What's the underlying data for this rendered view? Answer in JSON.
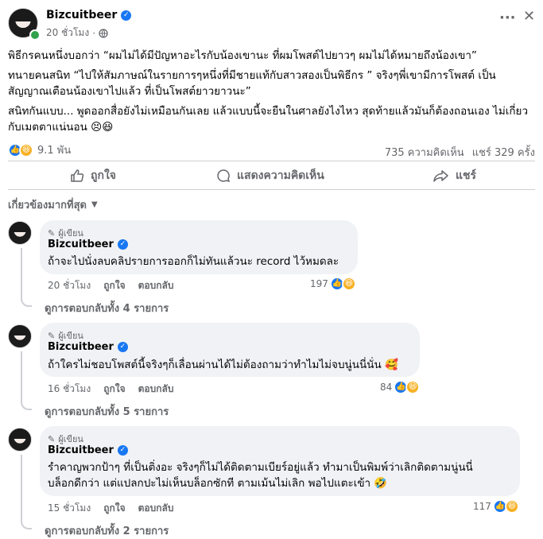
{
  "post": {
    "author": "Bizcuitbeer",
    "time": "20 ชั่วโมง",
    "privacy_icon": "globe-icon",
    "paragraphs": [
      "พิธีกรคนหนึ่งบอกว่า “ผมไม่ได้มีปัญหาอะไรกับน้องเขานะ ที่ผมโพสต์ไปยาวๆ ผมไม่ได้หมายถึงน้องเขา”",
      "ทนายคนสนิท “ไปให้สัมภาษณ์ในรายการๆหนึ่งที่มีชายแท้กับสาวสองเป็นพิธีกร ” จริงๆพี่เขามีการโพสต์ เป็นสัญญาณเตือนน้องเขาไปแล้ว ที่เป็นโพสต์ยาวยาวนะ”",
      "สนิทกันแบบ... พูดออกสื่อยังไม่เหมือนกันเลย แล้วแบบนี้จะยืนในศาลยังไงไหว สุดท้ายแล้วมันก็ต้องถอนเอง ไม่เกี่ยวกับเมตตาแน่นอน 😣😆"
    ],
    "reactions_count": "9.1 พัน",
    "comments_count": "735 ความคิดเห็น",
    "shares_count": "แชร์ 329 ครั้ง"
  },
  "actions": {
    "like": "ถูกใจ",
    "comment": "แสดงความคิดเห็น",
    "share": "แชร์"
  },
  "filter": {
    "label": "เกี่ยวข้องมากที่สุด"
  },
  "comments": [
    {
      "author_tag": "ผู้เขียน",
      "name": "Bizcuitbeer",
      "text": "ถ้าจะไปนั่งลบคลิปรายการออกก็ไม่ทันแล้วนะ record ไว้หมดละ",
      "time": "20 ชั่วโมง",
      "like": "ถูกใจ",
      "reply": "ตอบกลับ",
      "count": "197",
      "replies": "ดูการตอบกลับทั้ง 4 รายการ"
    },
    {
      "author_tag": "ผู้เขียน",
      "name": "Bizcuitbeer",
      "text": "ถ้าใครไม่ชอบโพสต์นี้จริงๆก็เลื่อนผ่านได้ไม่ต้องถามว่าทำไมไม่จบนู่นนี่นั่น 🥰",
      "time": "16 ชั่วโมง",
      "like": "ถูกใจ",
      "reply": "ตอบกลับ",
      "count": "84",
      "replies": "ดูการตอบกลับทั้ง 5 รายการ"
    },
    {
      "author_tag": "ผู้เขียน",
      "name": "Bizcuitbeer",
      "text_lines": [
        "รำคาญพวกป้าๆ ที่เป็นติ่งอะ จริงๆก็ไม่ได้ติดตามเบียร์อยู่แล้ว ทำมาเป็นพิมพ์ว่าเลิกติดตามนู่นนี่",
        "บล็อกดีกว่า แต่แปลกปะไม่เห็นบล็อกซักที ตามเม้นไม่เลิก พอไปแตะเข้า 🤣"
      ],
      "time": "15 ชั่วโมง",
      "like": "ถูกใจ",
      "reply": "ตอบกลับ",
      "count": "117",
      "replies": "ดูการตอบกลับทั้ง 2 รายการ"
    }
  ],
  "colors": {
    "accent": "#1877f2",
    "muted": "#65676b",
    "bubble": "#f0f2f5"
  }
}
